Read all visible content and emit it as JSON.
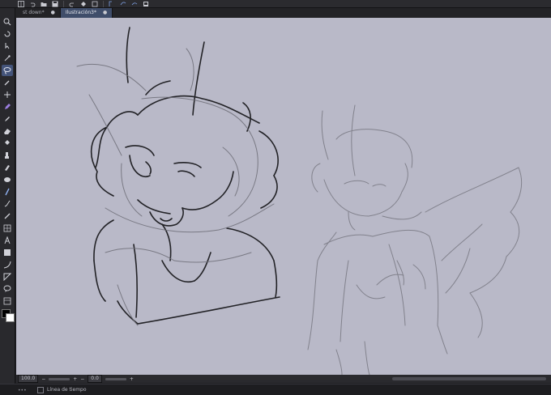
{
  "app": {
    "accent_color": "#44547a",
    "canvas_color": "#b9b9c8"
  },
  "topbar": {
    "icons": [
      "grid-icon",
      "undo-icon",
      "folder-icon",
      "save-icon",
      "redo-icon",
      "fill-icon",
      "transform-icon",
      "selection-icon",
      "lasso-icon",
      "layer-icon",
      "window-icon"
    ]
  },
  "tabs": [
    {
      "label": "st down*",
      "close": "●",
      "active": false
    },
    {
      "label": "Ilustración3*",
      "close": "●",
      "active": true
    }
  ],
  "toolbar": {
    "tools": [
      {
        "name": "zoom-tool",
        "icon": "magnifier-icon",
        "active": false
      },
      {
        "name": "rotate-tool",
        "icon": "rotate-icon",
        "active": false
      },
      {
        "name": "move-layer-tool",
        "icon": "move-layer-icon",
        "active": false
      },
      {
        "name": "auto-select-tool",
        "icon": "wand-icon",
        "active": false
      },
      {
        "name": "selection-tool",
        "icon": "lasso-icon",
        "active": true
      },
      {
        "name": "eyedropper-tool",
        "icon": "eyedropper-icon",
        "active": false
      },
      {
        "name": "move-tool",
        "icon": "arrows-icon",
        "active": false
      },
      {
        "name": "pen-tool",
        "icon": "pen-icon",
        "active": false
      },
      {
        "name": "pencil-tool",
        "icon": "pencil-icon",
        "active": false
      },
      {
        "name": "eraser-tool",
        "icon": "eraser-icon",
        "active": false
      },
      {
        "name": "fill-tool",
        "icon": "bucket-icon",
        "active": false
      },
      {
        "name": "brush-tool",
        "icon": "brush-icon",
        "active": false
      },
      {
        "name": "airbrush-tool",
        "icon": "airbrush-icon",
        "active": false
      },
      {
        "name": "blend-tool",
        "icon": "blend-icon",
        "active": false
      },
      {
        "name": "line-tool",
        "icon": "line-icon",
        "active": false
      },
      {
        "name": "curve-tool",
        "icon": "curve-icon",
        "active": false
      },
      {
        "name": "ruler-tool",
        "icon": "ruler-icon",
        "active": false
      },
      {
        "name": "frame-tool",
        "icon": "frame-icon",
        "active": false
      },
      {
        "name": "text-tool",
        "icon": "text-icon",
        "active": false
      },
      {
        "name": "gradient-tool",
        "icon": "gradient-icon",
        "active": false
      },
      {
        "name": "arc-tool",
        "icon": "arc-icon",
        "active": false
      },
      {
        "name": "vector-tool",
        "icon": "vector-icon",
        "active": false
      },
      {
        "name": "balloon-tool",
        "icon": "balloon-icon",
        "active": false
      },
      {
        "name": "panel-tool",
        "icon": "panel-icon",
        "active": false
      }
    ],
    "foreground_color": "#000000",
    "background_color": "#ffffff"
  },
  "statusbar": {
    "zoom": "100.0",
    "angle": "0.0",
    "zoom_minus": "−",
    "zoom_plus": "+",
    "angle_minus": "−",
    "angle_plus": "+"
  },
  "timeline": {
    "label": "Línea de tiempo",
    "dots": "•••"
  }
}
